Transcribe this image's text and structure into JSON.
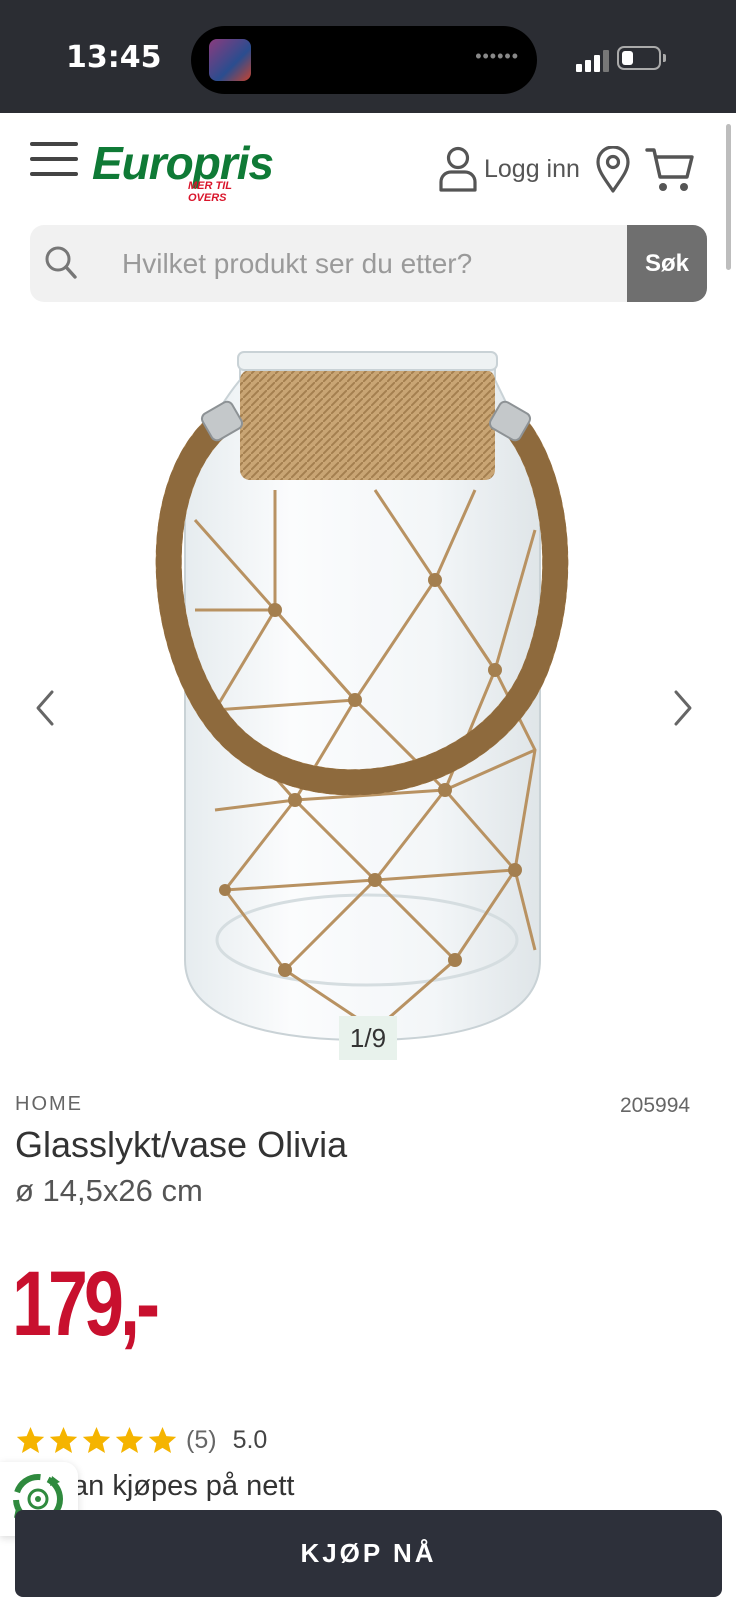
{
  "status_bar": {
    "time": "13:45",
    "island_dots": "••••••",
    "icons": [
      "island-thumbnail",
      "signal-icon",
      "battery-icon"
    ]
  },
  "header": {
    "logo_text": "Europris",
    "logo_tagline": "MER TIL OVERS",
    "login_label": "Logg inn",
    "icons": [
      "menu-icon",
      "user-icon",
      "map-pin-icon",
      "cart-icon"
    ]
  },
  "search": {
    "placeholder": "Hvilket produkt ser du etter?",
    "button_label": "Søk"
  },
  "gallery": {
    "counter": "1/9",
    "icons": [
      "chevron-left-icon",
      "chevron-right-icon"
    ]
  },
  "product": {
    "brand": "HOME",
    "sku": "205994",
    "title": "Glasslykt/vase Olivia",
    "subtitle": "ø 14,5x26 cm",
    "price": "179,-",
    "rating": {
      "stars": 5,
      "count": "(5)",
      "score": "5.0"
    },
    "availability": "an kjøpes på nett"
  },
  "buy_button": {
    "label": "KJØP NÅ"
  },
  "colors": {
    "brand_green": "#0f7a36",
    "brand_red": "#d9152b",
    "price_red": "#c8102e",
    "star": "#f5b400",
    "button_dark": "#2d303a"
  }
}
